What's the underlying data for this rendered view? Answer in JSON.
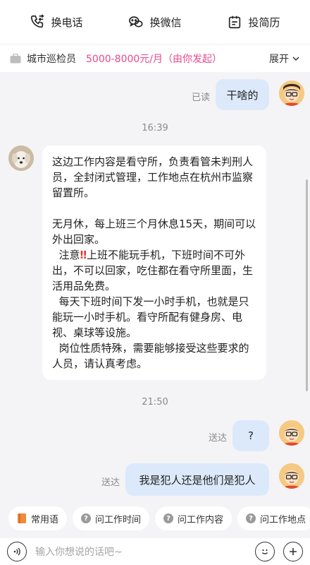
{
  "top_actions": [
    {
      "label": "换电话",
      "icon": "phone-swap-icon"
    },
    {
      "label": "换微信",
      "icon": "wechat-icon"
    },
    {
      "label": "投简历",
      "icon": "resume-icon"
    }
  ],
  "job": {
    "title": "城市巡检员",
    "salary": "5000-8000元/月（由你发起）",
    "expand_label": "展开"
  },
  "messages": {
    "m1": {
      "text": "干啥的",
      "status": "已读"
    },
    "t1": "16:39",
    "m2": {
      "p1": "这边工作内容是看守所，负责看管未判刑人员，全封闭式管理，工作地点在杭州市监察留置所。",
      "p2": "无月休，每上班三个月休息15天，期间可以外出回家。",
      "p3_prefix": "  注意",
      "p3_warn": "‼",
      "p3_rest": "上班不能玩手机，下班时间不可外出，不可以回家，吃住都在看守所里面，生活用品免费。",
      "p4": "  每天下班时间下发一小时手机，也就是只能玩一小时手机。看守所配有健身房、电视、桌球等设施。",
      "p5": "  岗位性质特殊，需要能够接受这些要求的人员，请认真考虑。"
    },
    "t2": "21:50",
    "m3": {
      "text": "?",
      "status": "送达"
    },
    "m4": {
      "text": "我是犯人还是他们是犯人",
      "status": "送达"
    }
  },
  "quick_replies": [
    "常用语",
    "问工作时间",
    "问工作内容",
    "问工作地点"
  ],
  "input": {
    "placeholder": "输入你想说的话吧~"
  },
  "colors": {
    "salary": "#e8498f",
    "bubble_self": "#dce9fb",
    "warn": "#e53935"
  }
}
